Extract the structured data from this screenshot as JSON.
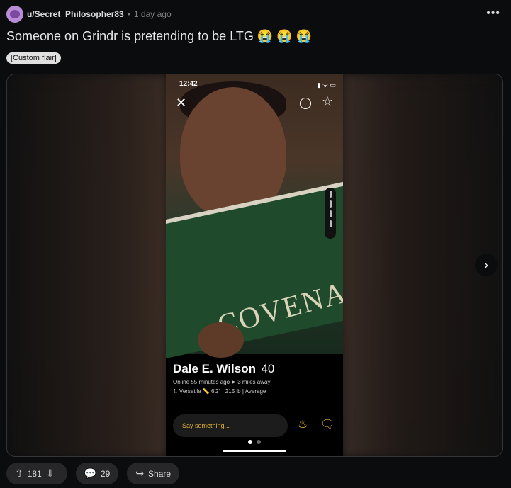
{
  "post": {
    "username": "u/Secret_Philosopher83",
    "separator": "•",
    "time": "1 day ago",
    "title": "Someone on Grindr is pretending to be LTG 😭 😭 😭",
    "flair": "[Custom flair]"
  },
  "media": {
    "status_time": "12:42",
    "status_icons": "▮ ᯤ ▭",
    "brand_text": "COVENANT",
    "profile_name": "Dale E. Wilson",
    "profile_age": "40",
    "meta_line1": "Online 55 minutes ago  ➤ 3 miles away",
    "meta_line2": "⇅ Versatile  📏 6'2\" | 215 lb | Average",
    "say_placeholder": "Say something..."
  },
  "actions": {
    "upvotes": "181",
    "comments": "29",
    "share": "Share"
  },
  "icons": {
    "more": "more-icon",
    "close": "close-icon",
    "star": "star-icon",
    "next": "chevron-right-icon"
  }
}
